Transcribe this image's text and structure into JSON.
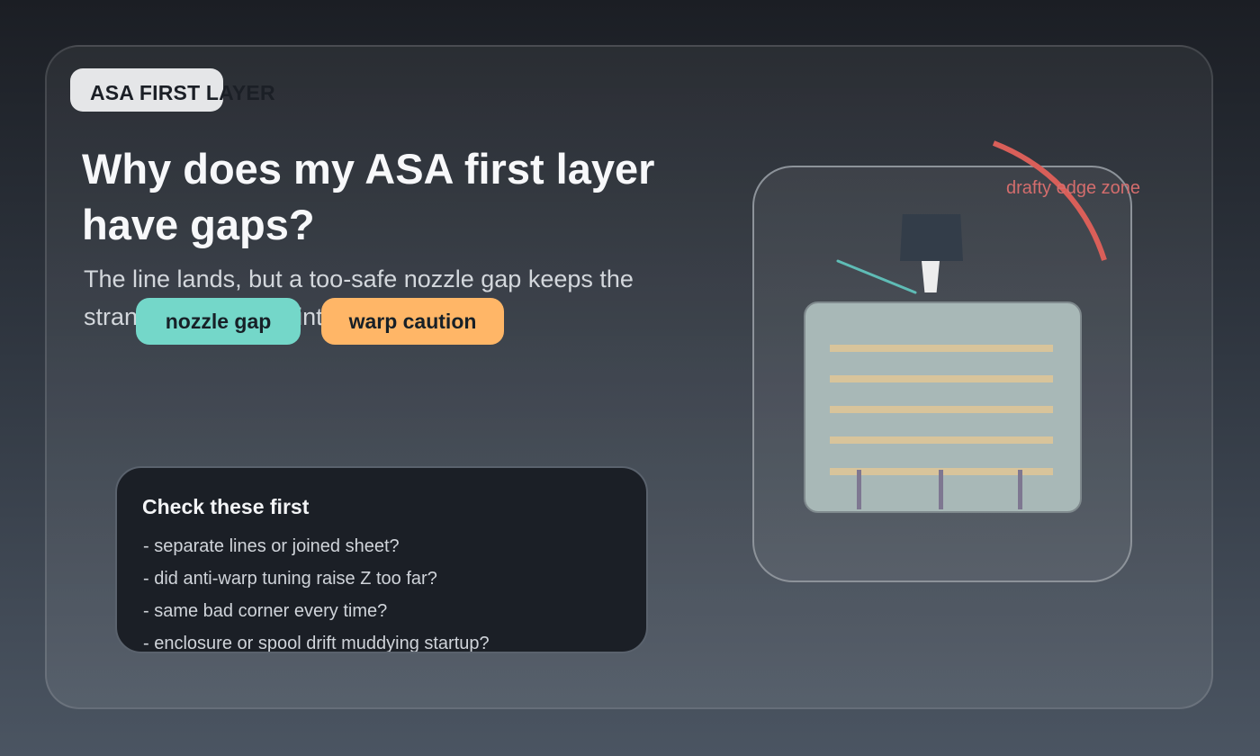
{
  "hero": {
    "eyebrow": "ASA FIRST LAYER",
    "title": "Why does my ASA first layer have gaps?",
    "subtitle": "The line lands, but a too-safe nozzle gap keeps the strands from fusing into a sheet."
  },
  "tags": {
    "nozzle_gap": "nozzle gap",
    "warp_caution": "warp caution"
  },
  "checklist": {
    "title": "Check these first",
    "items": [
      "- separate lines or joined sheet?",
      "- did anti-warp tuning raise Z too far?",
      "- same bad corner every time?",
      "- enclosure or spool drift muddying startup?"
    ]
  },
  "illustration": {
    "draft_label": "drafty edge zone",
    "colors": {
      "filament": "#d8c49b",
      "bed": "#a8b8b7",
      "nozzle": "#333d49",
      "draft": "#d95f59",
      "airflow": "#5fbcb6"
    },
    "icons": [
      "nozzle-icon",
      "print-bed-icon",
      "filament-strand-icon",
      "airflow-line-icon",
      "draft-arc-icon"
    ]
  },
  "theme": {
    "teal": "#74d7c9",
    "orange": "#ffb667",
    "background": "#2d333d"
  }
}
